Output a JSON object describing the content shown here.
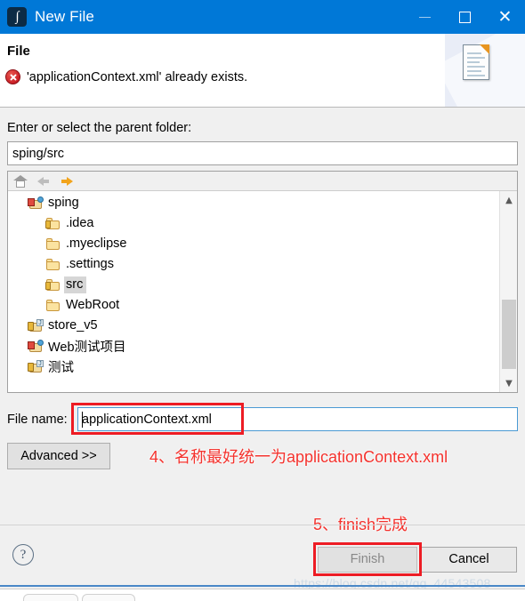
{
  "window": {
    "title": "New File",
    "icon": "myeclipse-icon",
    "accent_color": "#0078d7",
    "controls": {
      "minimize": "minimize-icon",
      "maximize": "maximize-icon",
      "close": "close-icon"
    }
  },
  "header": {
    "title": "File",
    "message": "'applicationContext.xml' already exists.",
    "message_icon": "error-icon",
    "banner_icon": "document-icon"
  },
  "parent_folder": {
    "label": "Enter or select the parent folder:",
    "value": "sping/src",
    "placeholder": ""
  },
  "tree_toolbar": {
    "home": "home-icon",
    "back": "back-arrow-icon",
    "forward": "forward-arrow-icon"
  },
  "tree": {
    "items": [
      {
        "label": "sping",
        "indent": 0,
        "icon": "project-icon",
        "selected": false
      },
      {
        "label": ".idea",
        "indent": 1,
        "icon": "folder-locked-icon",
        "selected": false
      },
      {
        "label": ".myeclipse",
        "indent": 1,
        "icon": "folder-icon",
        "selected": false
      },
      {
        "label": ".settings",
        "indent": 1,
        "icon": "folder-icon",
        "selected": false
      },
      {
        "label": "src",
        "indent": 1,
        "icon": "folder-locked-icon",
        "selected": true
      },
      {
        "label": "WebRoot",
        "indent": 1,
        "icon": "folder-icon",
        "selected": false
      },
      {
        "label": "store_v5",
        "indent": 0,
        "icon": "project-java-icon",
        "selected": false
      },
      {
        "label": "Web测试项目",
        "indent": 0,
        "icon": "project-icon",
        "selected": false
      },
      {
        "label": "测试",
        "indent": 0,
        "icon": "project-java-icon",
        "selected": false
      }
    ],
    "scrollbar": {
      "up": "chevron-up-icon",
      "down": "chevron-down-icon"
    }
  },
  "file_name": {
    "label": "File name:",
    "value": "applicationContext.xml",
    "placeholder": ""
  },
  "buttons": {
    "advanced": "Advanced >>",
    "finish": "Finish",
    "cancel": "Cancel",
    "help": "?"
  },
  "annotations": {
    "color": "#f4332e",
    "step4": "4、名称最好统一为applicationContext.xml",
    "step5": "5、finish完成"
  },
  "watermark": "https://blog.csdn.net/qq_44543508"
}
